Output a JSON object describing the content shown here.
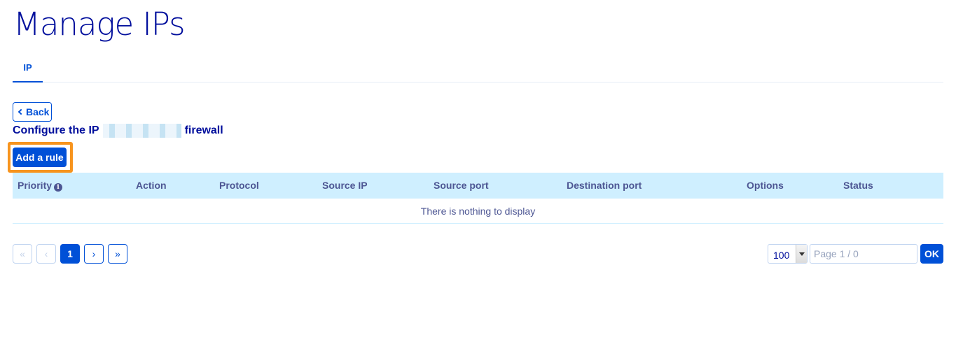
{
  "page": {
    "title": "Manage IPs"
  },
  "tabs": [
    {
      "label": "IP",
      "active": true
    }
  ],
  "back_button": {
    "label": "Back",
    "icon": "chevron-left-icon"
  },
  "subtitle": {
    "prefix": "Configure the IP",
    "suffix": "firewall"
  },
  "add_rule_button": {
    "label": "Add a rule",
    "highlight_color": "#f7941e"
  },
  "table": {
    "columns": [
      "Priority",
      "Action",
      "Protocol",
      "Source IP",
      "Source port",
      "Destination port",
      "Options",
      "Status"
    ],
    "empty_message": "There is nothing to display"
  },
  "pagination": {
    "first": "«",
    "prev": "‹",
    "current": "1",
    "next": "›",
    "last": "»",
    "per_page": "100",
    "page_placeholder": "Page 1 / 0",
    "ok_label": "OK"
  },
  "colors": {
    "brand": "#0050d7",
    "title": "#000e9c",
    "table_header_bg": "#cfefff"
  }
}
